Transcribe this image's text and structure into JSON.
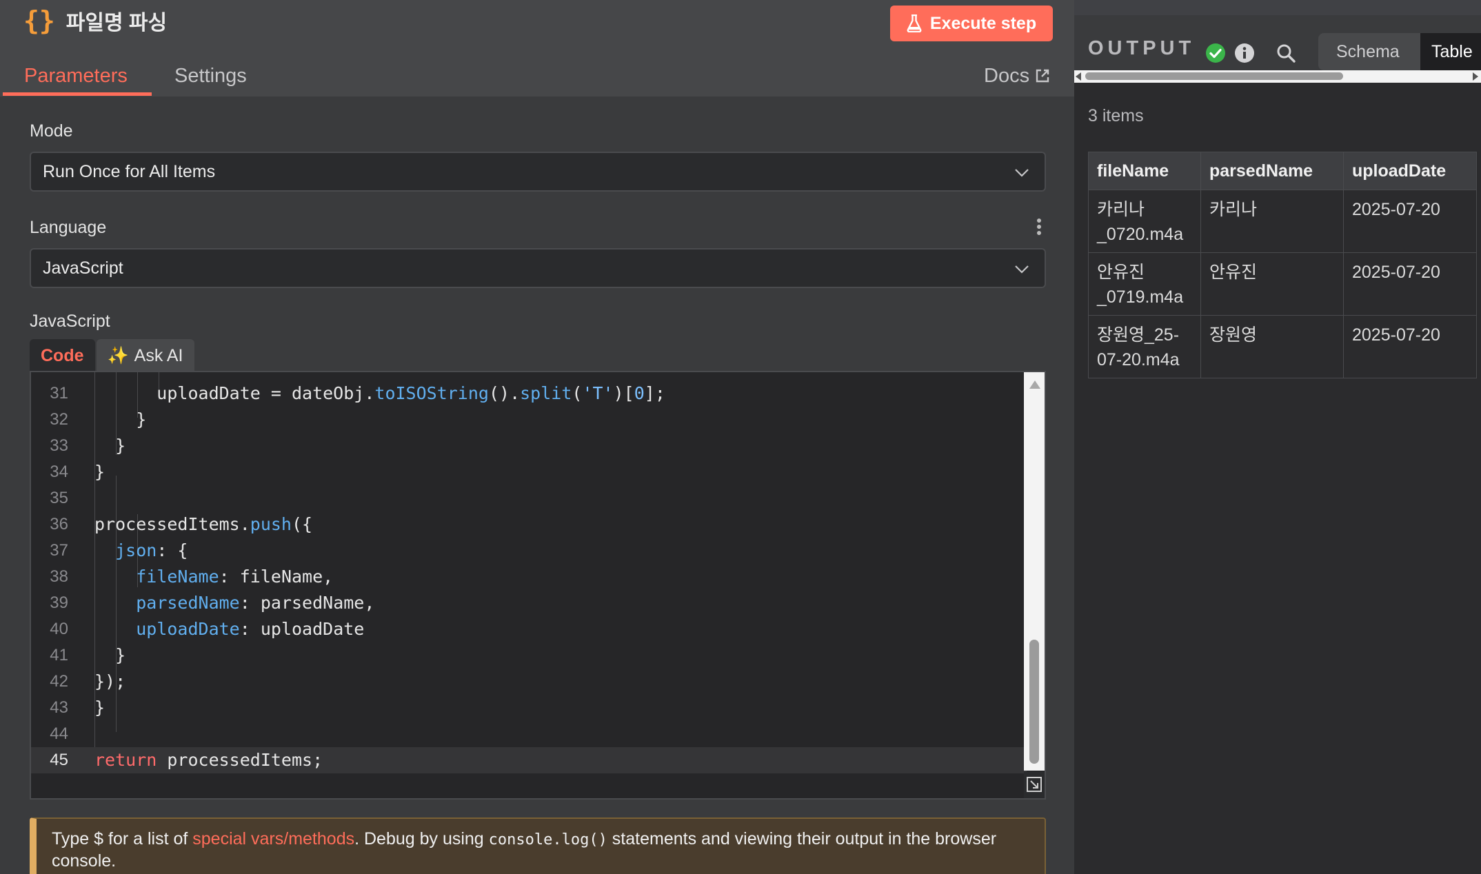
{
  "node": {
    "title": "파일명 파싱",
    "braces_icon": "{}"
  },
  "header": {
    "execute_label": "Execute step",
    "tabs": [
      {
        "label": "Parameters",
        "active": true
      },
      {
        "label": "Settings",
        "active": false
      }
    ],
    "docs_label": "Docs"
  },
  "form": {
    "mode": {
      "label": "Mode",
      "value": "Run Once for All Items"
    },
    "language": {
      "label": "Language",
      "value": "JavaScript"
    },
    "code_label": "JavaScript",
    "code_tabs": {
      "code": "Code",
      "ask_ai": "Ask AI",
      "ask_ai_icon": "✨"
    }
  },
  "editor": {
    "lines": [
      {
        "n": "31",
        "code": "      uploadDate = dateObj.toISOString().split('T')[0];"
      },
      {
        "n": "32",
        "code": "    }"
      },
      {
        "n": "33",
        "code": "  }"
      },
      {
        "n": "34",
        "code": "}"
      },
      {
        "n": "35",
        "code": ""
      },
      {
        "n": "36",
        "code": "processedItems.push({"
      },
      {
        "n": "37",
        "code": "  json: {"
      },
      {
        "n": "38",
        "code": "    fileName: fileName,"
      },
      {
        "n": "39",
        "code": "    parsedName: parsedName,"
      },
      {
        "n": "40",
        "code": "    uploadDate: uploadDate"
      },
      {
        "n": "41",
        "code": "  }"
      },
      {
        "n": "42",
        "code": "});"
      },
      {
        "n": "43",
        "code": "}"
      },
      {
        "n": "44",
        "code": ""
      },
      {
        "n": "45",
        "code": "return processedItems;"
      }
    ],
    "active_line": "45"
  },
  "hint": {
    "prefix": "Type $ for a list of ",
    "link": "special vars/methods",
    "middle": ". Debug by using ",
    "code": "console.log()",
    "suffix": " statements and viewing their output in the browser console."
  },
  "output": {
    "title": "OUTPUT",
    "status_icon": "check-circle",
    "views": {
      "schema": "Schema",
      "table": "Table"
    },
    "items_count": "3 items",
    "columns": [
      "fileName",
      "parsedName",
      "uploadDate"
    ],
    "rows": [
      [
        "카리나_0720.m4a",
        "카리나",
        "2025-07-20"
      ],
      [
        "안유진_0719.m4a",
        "안유진",
        "2025-07-20"
      ],
      [
        "장원영_25-07-20.m4a",
        "장원영",
        "2025-07-20"
      ]
    ]
  },
  "colors": {
    "accent": "#ff6d5a",
    "success": "#3bb54a",
    "warning_border": "#e0ad62"
  }
}
